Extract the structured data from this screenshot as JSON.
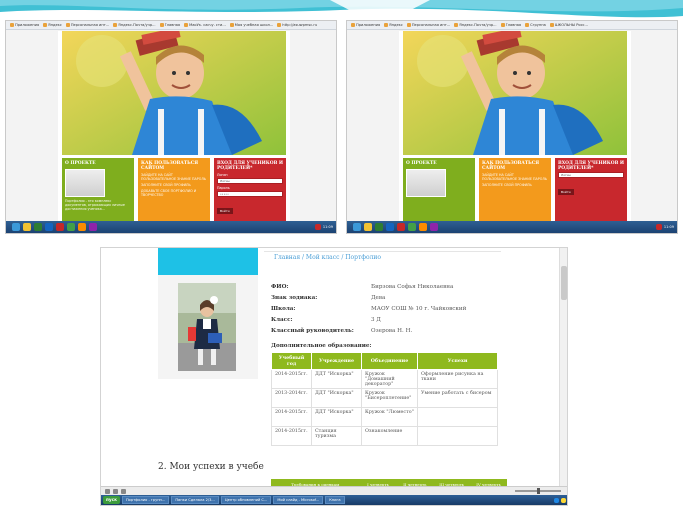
{
  "colors": {
    "banner_teal": "#2bb9cf",
    "green": "#7fae1e",
    "orange": "#f39a1c",
    "red": "#c8282d",
    "cyan": "#1ec1e6",
    "taskbar": "#1f4b80"
  },
  "browser": {
    "bookmarks": [
      "Приложения",
      "Яндекс",
      "Персональная инт...",
      "Яндекс.Почта/учр...",
      "Главная",
      "МаоУк. сасчу. сти...",
      "Моя учебная школ...",
      "http://asuwpmsc.ru",
      "Сгруппа",
      "ШКОЛЬНЫ Росс..."
    ]
  },
  "site": {
    "cards": {
      "about_title": "О ПРОЕКТЕ",
      "about_text": "Портфолио - это комплекс документов, отражающих личные достижения ученика...",
      "howto_title": "КАК ПОЛЬЗОВАТЬСЯ САЙТОМ",
      "howto_links": [
        "ЗАЙДИТЕ НА САЙТ ПОЛЬЗОВАТЕЛЬНОЕ ЗНАНИЕ ПАРОЛЬ",
        "ЗАПОЛНИТЕ СВОЙ ПРОФИЛЬ",
        "ДОБАВЬТЕ СВОЕ ПОРТФОЛИО И ТВОРЧЕСТВО"
      ],
      "login_title": "ВХОД ДЛЯ УЧЕНИКОВ И РОДИТЕЛЕЙ*",
      "login_label": "Логин",
      "login_value": "Логин",
      "password_label": "Пароль",
      "password_value": "•••••",
      "login_button": "Войти"
    }
  },
  "portfolio": {
    "breadcrumb": "Главная / Мой класс / Портфолио",
    "fields": [
      {
        "key": "ФИО:",
        "value": "Бирзова Софья Николаевна"
      },
      {
        "key": "Знак зодиака:",
        "value": "Дева"
      },
      {
        "key": "Школа:",
        "value": "МАОУ СОШ № 10 г. Чайковский"
      },
      {
        "key": "Класс:",
        "value": "3 Д"
      },
      {
        "key": "Классный руководитель:",
        "value": "Озерова Н. Н."
      }
    ],
    "additional_education_label": "Дополнительное образование:",
    "table": {
      "headers": [
        "Учебный год",
        "Учреждение",
        "Объединение",
        "Успехи"
      ],
      "rows": [
        [
          "2014-2015гг.",
          "ДДТ \"Искорка\"",
          "Кружок \"Домашний декоратор\"",
          "Оформление рисунка на ткани"
        ],
        [
          "2013-2014гг.",
          "ДДТ \"Искорка\"",
          "Кружок \"Бисероплетение\"",
          "Умение работать с бисером"
        ],
        [
          "2014-2015гг.",
          "ДДТ \"Искорка\"",
          "Кружок \"Люместо\"",
          ""
        ],
        [
          "2014-2015гг.",
          "Станция туризма",
          "Ознакомление",
          ""
        ]
      ]
    },
    "section2_title": "2. Мои успехи в учебе",
    "grades_headers": [
      "Требования к оценкам",
      "I четверть",
      "II четверть",
      "III четверть",
      "IV четверть"
    ]
  },
  "taskbar": {
    "start_label": "пуск",
    "tasks": [
      "Портфолио - групп...",
      "Папки Сделала 2/3...",
      "Центр обновлений С...",
      "Мой слайд - Microsof...",
      "Книга"
    ],
    "clock_left": "11:09",
    "clock_right": "11:09"
  }
}
